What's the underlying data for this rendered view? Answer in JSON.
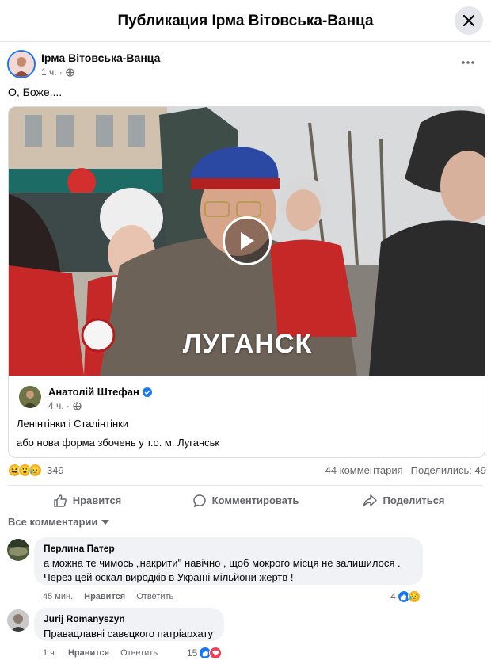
{
  "header": {
    "title": "Публикация Ірма Вітовська-Ванца"
  },
  "post": {
    "author": "Ірма Вітовська-Ванца",
    "time": "1 ч. ·",
    "text": "О, Боже....",
    "shared": {
      "video_caption": "ЛУГАНСК",
      "author": "Анатолій Штефан",
      "time": "4 ч. ·",
      "line1": "Ленінтінки і Сталінтінки",
      "line2": "або нова форма збочень у т.о. м. Луганськ"
    },
    "stats": {
      "reaction_count": "349",
      "comments": "44 комментария",
      "shares": "Поделились: 49"
    },
    "actions": {
      "like": "Нравится",
      "comment": "Комментировать",
      "share": "Поделиться"
    }
  },
  "comments_sort": "Все комментарии",
  "comments": [
    {
      "name": "Перлина Патер",
      "line1": "а можна те чимось „накрити'' навічно , щоб мокрого місця не залишилося .",
      "line2": "Через цей оскал виродків в Україні мільйони жертв !",
      "time": "45 мин.",
      "like": "Нравится",
      "reply": "Ответить",
      "reactions": "4"
    },
    {
      "name": "Jurij Romanyszyn",
      "line1": "Правацлавні савєцкого патріархату",
      "time": "1 ч.",
      "like": "Нравится",
      "reply": "Ответить",
      "reactions": "15"
    }
  ],
  "colors": {
    "accent": "#1877f2",
    "secondary_text": "#65676b",
    "bubble": "#f0f2f5",
    "love": "#f33e58",
    "haha": "#f7b125"
  },
  "icons": [
    "close-icon",
    "globe-icon",
    "more-icon",
    "play-icon",
    "verified-icon",
    "like-icon",
    "comment-icon",
    "share-icon",
    "chevron-down-icon"
  ]
}
